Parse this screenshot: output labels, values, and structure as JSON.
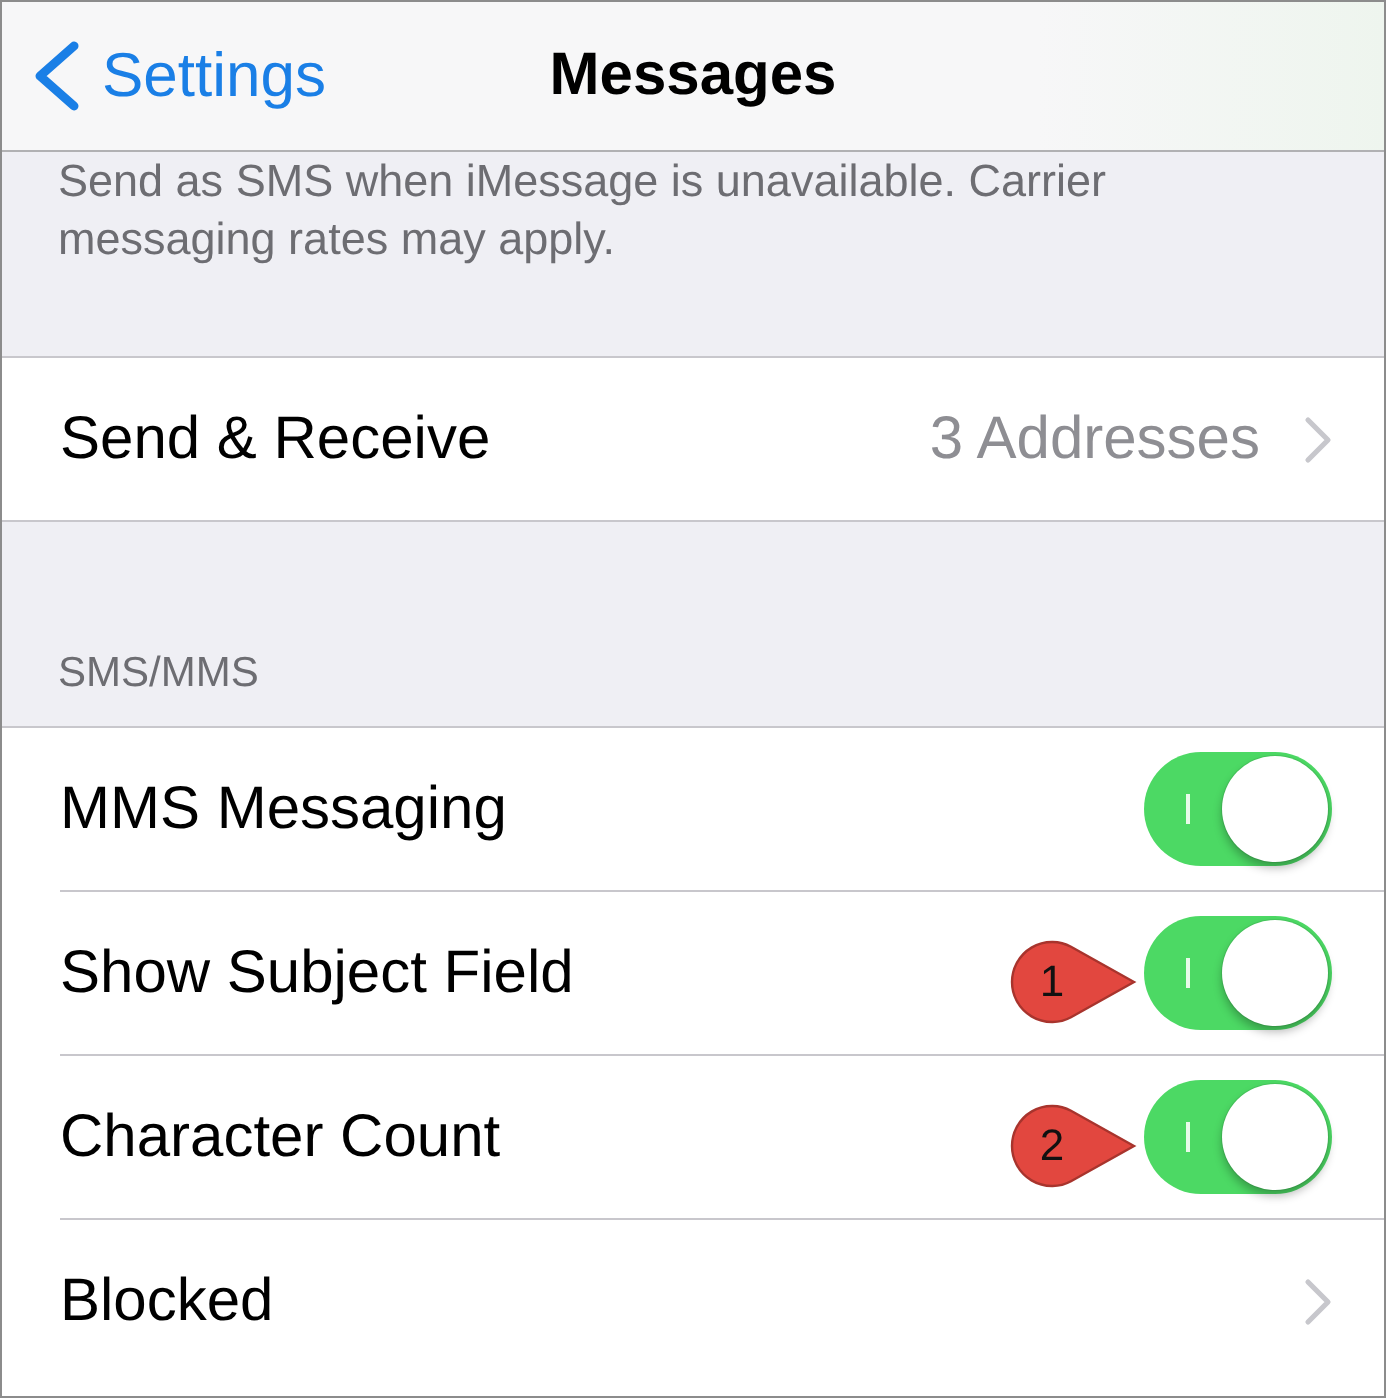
{
  "nav_bar": {
    "back_label": "Settings",
    "title": "Messages"
  },
  "imessage_footer": "Send as SMS when iMessage is unavailable. Carrier messaging rates may apply.",
  "groups": [
    {
      "rows": [
        {
          "kind": "link",
          "label": "Send & Receive",
          "value": "3 Addresses"
        }
      ]
    },
    {
      "header": "SMS/MMS",
      "rows": [
        {
          "kind": "toggle",
          "label": "MMS Messaging",
          "on": true
        },
        {
          "kind": "toggle",
          "label": "Show Subject Field",
          "on": true,
          "callout": "1"
        },
        {
          "kind": "toggle",
          "label": "Character Count",
          "on": true,
          "callout": "2"
        },
        {
          "kind": "link",
          "label": "Blocked"
        }
      ]
    }
  ]
}
